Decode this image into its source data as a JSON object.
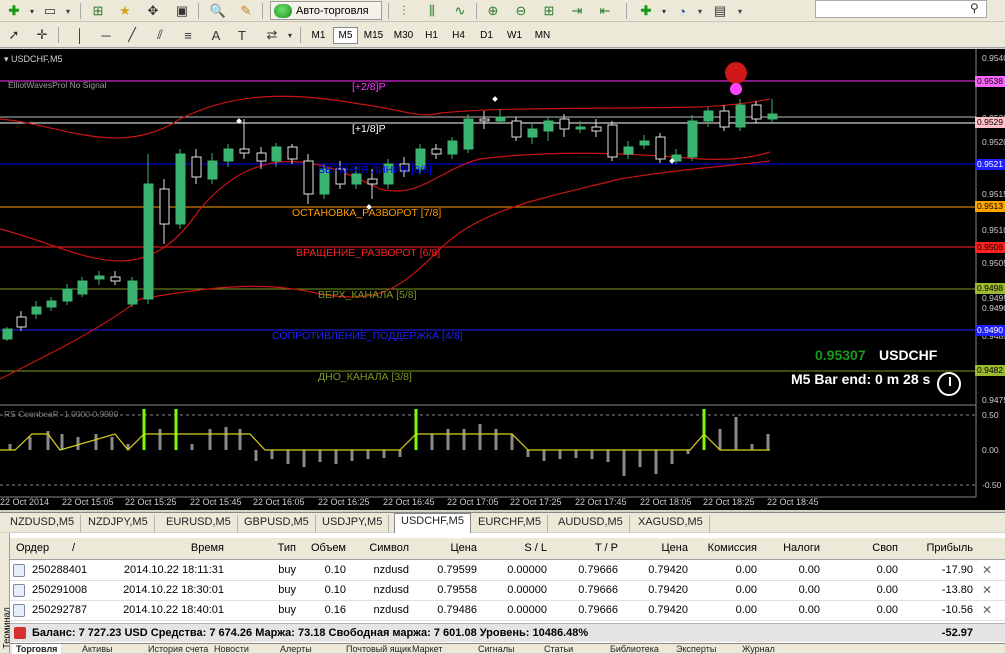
{
  "toolbar": {
    "autotrade_label": "Авто-торговля",
    "timeframes": [
      "M1",
      "M5",
      "M15",
      "M30",
      "H1",
      "H4",
      "D1",
      "W1",
      "MN"
    ],
    "active_timeframe": "M5"
  },
  "chart": {
    "symbol_title": "USDCHF,M5",
    "indicator_title": "ElliotWavesProl No Signal",
    "levels": [
      {
        "label": "[+2/8]P",
        "color": "#ff33ff"
      },
      {
        "label": "[+1/8]P",
        "color": "#ffffff"
      },
      {
        "label": "ВЕРХНЯЯ ЛИНИЯ [8/8]",
        "color": "#0000ff"
      },
      {
        "label": "ОСТАНОВКА_РАЗВОРОТ [7/8]",
        "color": "#ff9900"
      },
      {
        "label": "ВРАЩЕНИЕ_РАЗВОРОТ [6/8]",
        "color": "#ff2020"
      },
      {
        "label": "ВЕРХ_КАНАЛА [5/8]",
        "color": "#7a9a20"
      },
      {
        "label": "СОПРОТИВЛЕНИЕ_ПОДДЕРЖКА [4/8]",
        "color": "#2020ff"
      },
      {
        "label": "ДНО_КАНАЛА [3/8]",
        "color": "#7a9a20"
      }
    ],
    "price_axis": [
      "0.9540",
      "0.9535",
      "0.9529",
      "0.9520",
      "0.9515",
      "0.9510",
      "0.9505",
      "0.9500",
      "0.9495",
      "0.9490",
      "0.9485",
      "0.9480",
      "0.9475"
    ],
    "price_tags": [
      "0.9538",
      "0.9529",
      "0.9521",
      "0.9513",
      "0.9506",
      "0.9498",
      "0.9490",
      "0.9482"
    ],
    "current_price": "0.95307",
    "current_symbol": "USDCHF",
    "bar_end_text": "M5 Bar end: 0 m 28 s",
    "sub_title": "RS CoonbeaR -1.0000 0.9990",
    "sub_axis": [
      "0.50",
      "0.00",
      "-0.50"
    ],
    "time_labels": [
      "22 Oct 2014",
      "22 Oct 15:05",
      "22 Oct 15:25",
      "22 Oct 15:45",
      "22 Oct 16:05",
      "22 Oct 16:25",
      "22 Oct 16:45",
      "22 Oct 17:05",
      "22 Oct 17:25",
      "22 Oct 17:45",
      "22 Oct 18:05",
      "22 Oct 18:25",
      "22 Oct 18:45"
    ]
  },
  "symbol_tabs": [
    "NZDUSD,M5",
    "NZDJPY,M5",
    "EURUSD,M5",
    "GBPUSD,M5",
    "USDJPY,M5",
    "USDCHF,M5",
    "EURCHF,M5",
    "AUDUSD,M5",
    "XAGUSD,M5"
  ],
  "active_symbol_tab": "USDCHF,M5",
  "terminal": {
    "side_label": "Терминал",
    "columns": [
      "Ордер",
      "/",
      "Время",
      "Тип",
      "Объем",
      "Символ",
      "Цена",
      "S / L",
      "T / P",
      "Цена",
      "Комиссия",
      "Налоги",
      "Своп",
      "Прибыль"
    ],
    "orders": [
      {
        "order": "250288401",
        "time": "2014.10.22 18:11:31",
        "type": "buy",
        "volume": "0.10",
        "symbol": "nzdusd",
        "price": "0.79599",
        "sl": "0.00000",
        "tp": "0.79666",
        "cur": "0.79420",
        "commission": "0.00",
        "taxes": "0.00",
        "swap": "0.00",
        "profit": "-17.90"
      },
      {
        "order": "250291008",
        "time": "2014.10.22 18:30:01",
        "type": "buy",
        "volume": "0.10",
        "symbol": "nzdusd",
        "price": "0.79558",
        "sl": "0.00000",
        "tp": "0.79666",
        "cur": "0.79420",
        "commission": "0.00",
        "taxes": "0.00",
        "swap": "0.00",
        "profit": "-13.80"
      },
      {
        "order": "250292787",
        "time": "2014.10.22 18:40:01",
        "type": "buy",
        "volume": "0.16",
        "symbol": "nzdusd",
        "price": "0.79486",
        "sl": "0.00000",
        "tp": "0.79666",
        "cur": "0.79420",
        "commission": "0.00",
        "taxes": "0.00",
        "swap": "0.00",
        "profit": "-10.56"
      }
    ],
    "balance_line": "Баланс: 7 727.23 USD  Средства: 7 674.26  Маржа: 73.18  Свободная маржа: 7 601.08  Уровень: 10486.48%",
    "total_profit": "-52.97",
    "bottom_tabs": [
      "Торговля",
      "Активы",
      "История счета",
      "Новости",
      "Алерты",
      "Почтовый ящик",
      "Маркет",
      "Сигналы",
      "Статьи",
      "Библиотека",
      "Эксперты",
      "Журнал"
    ]
  }
}
